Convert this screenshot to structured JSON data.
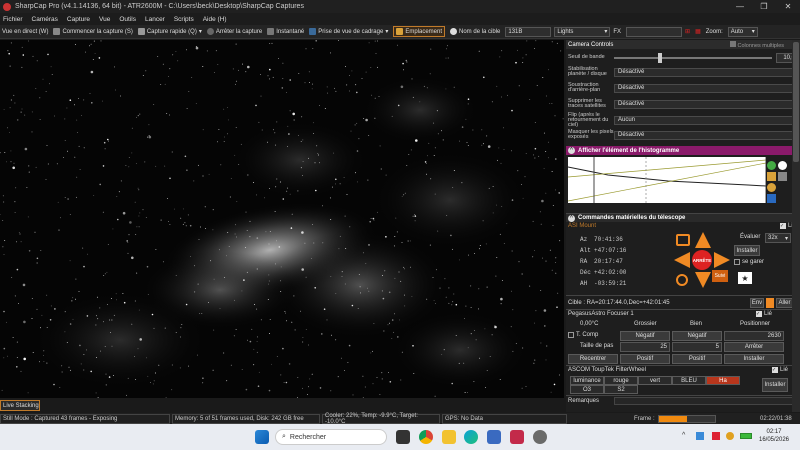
{
  "title": "SharpCap Pro (v4.1.14136, 64 bit) - ATR2600M - C:\\Users\\beck\\Desktop\\SharpCap Captures",
  "menu": [
    "Fichier",
    "Caméras",
    "Capture",
    "Vue",
    "Outils",
    "Lancer",
    "Scripts",
    "Aide (H)"
  ],
  "toolbar": {
    "live": "Vue en direct (W)",
    "start_capture": "Commencer la capture (S)",
    "quick_capture": "Capture rapide (Q)",
    "stop_capture": "Arrêter la capture",
    "snapshot": "Instantané",
    "framing": "Prise de vue de cadrage",
    "placement": "Emplacement",
    "target_label": "Nom de la cible",
    "target_value": "131B",
    "frame_type": "Lights",
    "fx_label": "FX",
    "zoom_label": "Zoom:",
    "zoom_value": "Auto"
  },
  "camera_controls": {
    "header": "Camera Controls",
    "multi_col": "Colonnes multiples",
    "threshold_label": "Seuil de bande",
    "threshold_value": "10,0",
    "rows": [
      {
        "label": "Stabilisation planète / disque",
        "value": "Désactivé"
      },
      {
        "label": "Soustraction d'arrière-plan",
        "value": "Désactivé"
      },
      {
        "label": "Supprimer les traces satellites",
        "value": "Désactivé"
      },
      {
        "label": "Flip (après le retournement du ciel)",
        "value": "Aucun"
      },
      {
        "label": "Masquer les pixels exposés",
        "value": "Désactivé"
      }
    ]
  },
  "histogram": {
    "header": "Afficher l'élément de l'histogramme"
  },
  "telescope": {
    "header": "Commandes matérielles du télescope",
    "mount_name": "ASI Mount",
    "linked": "Lié",
    "az_label": "Az",
    "az": "70:41:36",
    "alt_label": "Alt",
    "alt": "+47:07:16",
    "ra_label": "RA",
    "ra": "20:17:47",
    "dec_label": "Déc",
    "dec": "+42:02:00",
    "ah_label": "AH",
    "ah": "-03:59:21",
    "evaluate": "Évaluer",
    "rate": "32x",
    "install": "Installer",
    "park": "se garer",
    "stop": "ARRÊTE",
    "follow": "Suivi",
    "target": "Cible : RA=20:17:44.0,Dec=+42:01:45",
    "env": "Env",
    "goto": "Aller à"
  },
  "focuser": {
    "name": "PegasusAstro Focuser 1",
    "linked": "Lié",
    "temp": "0,00°C",
    "coarse": "Grossier",
    "fine": "Bien",
    "position": "Positionner",
    "tcomp": "T. Comp",
    "neg": "Négatif",
    "pos_value": "2630",
    "step_label": "Taille de pas",
    "coarse_step": "25",
    "fine_step": "5",
    "stop": "Arrêter",
    "recenter": "Recentrer",
    "positive": "Positif",
    "install": "Installer"
  },
  "filterwheel": {
    "name": "ASCOM ToupTek FilterWheel",
    "linked": "Lié",
    "filters": [
      "luminance",
      "rouge",
      "vert",
      "BLEU",
      "Ha",
      "O3",
      "S2"
    ],
    "active": "Ha",
    "install": "Installer"
  },
  "remarks": "Remarques",
  "live_stacking": "Live Stacking",
  "status": {
    "mode": "Still Mode : Captured 43 frames - Exposing",
    "memory": "Memory: 5 of 51 frames used, Disk: 242 GB free",
    "cooler": "Cooler: 22%, Temp: -9.9°C, Target: -10.0°C",
    "gps": "GPS: No Data",
    "frame_label": "Frame :",
    "frame_progress": 0.5,
    "elapsed": "02:22/01:38"
  },
  "taskbar": {
    "search": "Rechercher",
    "time": "02:17",
    "date": "16/05/2026"
  },
  "colors": {
    "accent": "#c07a2a",
    "histogram_header": "#8a1a6a",
    "arrow": "#f08a24",
    "stop": "#d22"
  }
}
